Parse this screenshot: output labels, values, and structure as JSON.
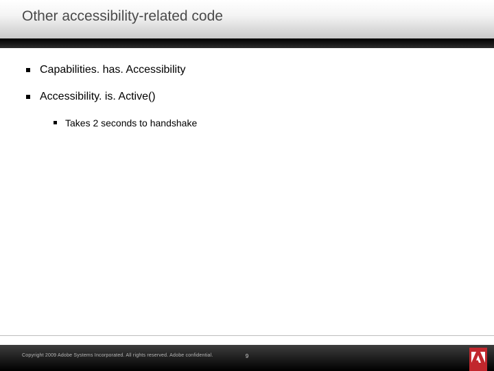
{
  "slide": {
    "title": "Other accessibility-related code",
    "bullets": [
      {
        "text": "Capabilities. has. Accessibility"
      },
      {
        "text": "Accessibility. is. Active()",
        "children": [
          {
            "text": "Takes 2 seconds to handshake"
          }
        ]
      }
    ],
    "footer": {
      "copyright": "Copyright 2009 Adobe Systems Incorporated.  All rights reserved.  Adobe confidential.",
      "page": "9"
    },
    "brand": {
      "name": "adobe-logo",
      "color": "#c1272d"
    }
  }
}
